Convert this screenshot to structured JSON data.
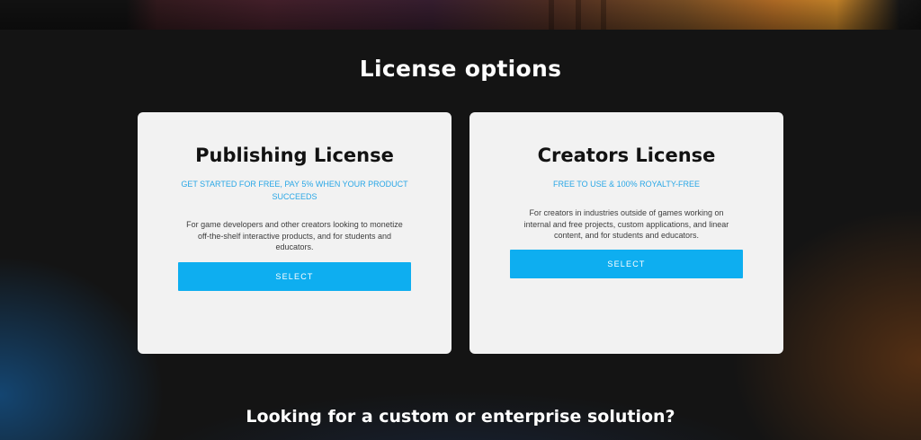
{
  "page": {
    "title": "License options",
    "footer_title": "Looking for a custom or enterprise solution?"
  },
  "licenses": [
    {
      "name": "Publishing License",
      "tagline": "GET STARTED FOR FREE, PAY 5% WHEN YOUR PRODUCT SUCCEEDS",
      "description": "For game developers and other creators looking to monetize off-the-shelf interactive products, and for students and educators.",
      "button_label": "SELECT"
    },
    {
      "name": "Creators License",
      "tagline": "FREE TO USE & 100% ROYALTY-FREE",
      "description": "For creators in industries outside of games working on internal and free projects, custom applications, and linear content, and for students and educators.",
      "button_label": "SELECT"
    }
  ],
  "colors": {
    "background": "#141414",
    "card": "#f2f2f2",
    "accent": "#0eaef0",
    "tagline": "#2aa7e6"
  }
}
